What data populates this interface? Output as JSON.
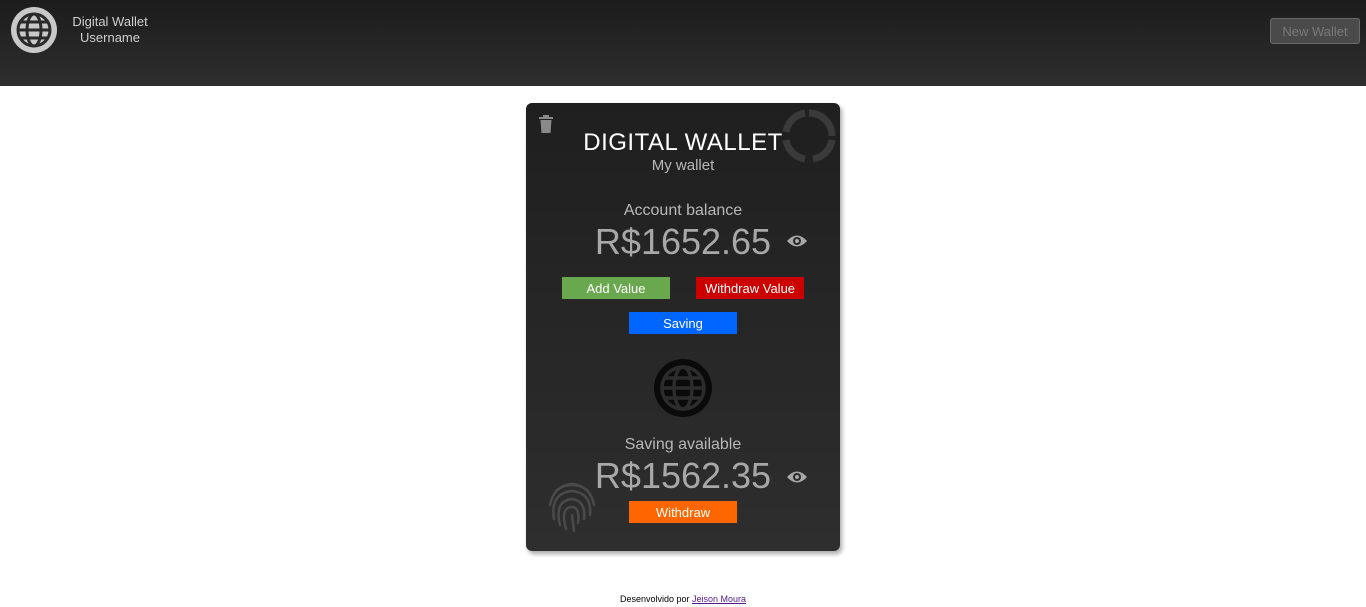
{
  "header": {
    "app_title": "Digital Wallet",
    "username": "Username",
    "new_wallet_label": "New Wallet"
  },
  "card": {
    "title": "DIGITAL WALLET",
    "subtitle": "My wallet",
    "balance_label": "Account balance",
    "balance_value": "R$1652.65",
    "add_value_label": "Add Value",
    "withdraw_value_label": "Withdraw Value",
    "saving_label": "Saving",
    "saving_available_label": "Saving available",
    "saving_value": "R$1562.35",
    "withdraw_label": "Withdraw"
  },
  "footer": {
    "prefix": "Desenvolvido por",
    "author": "Jeison Moura"
  },
  "icons": {
    "header_globe": "globe-icon",
    "trash": "trash-icon",
    "spinner": "spinner-icon",
    "eye": "eye-icon",
    "globe": "globe-icon",
    "fingerprint": "fingerprint-icon"
  },
  "colors": {
    "add": "#6aa84f",
    "withdraw_value": "#cc0000",
    "saving": "#0066ff",
    "withdraw": "#ff6600"
  }
}
